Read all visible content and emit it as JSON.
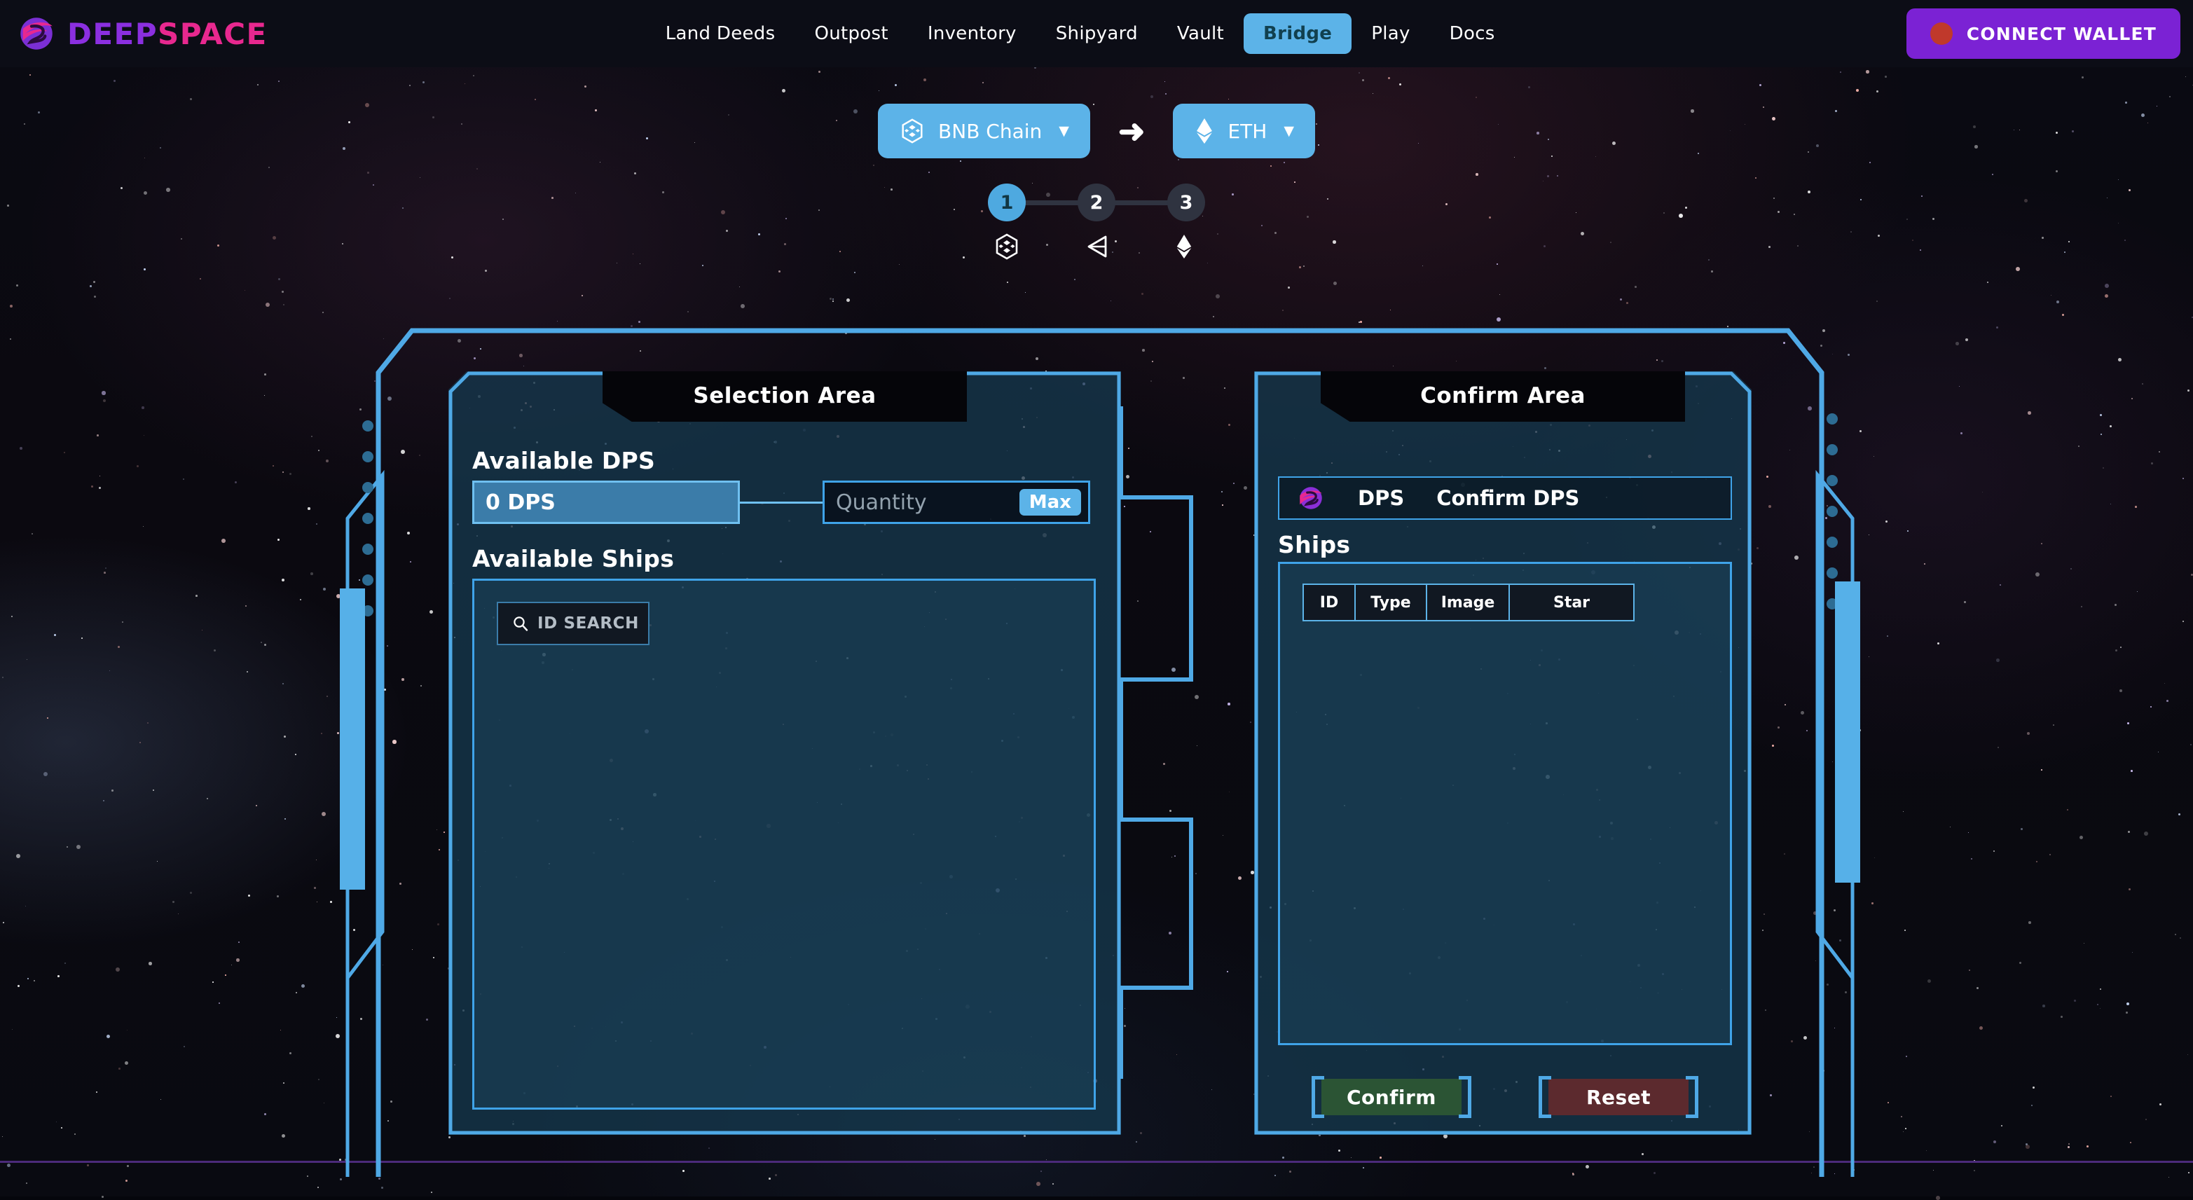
{
  "brand": {
    "name_part1": "DEEP",
    "name_part2": "SPACE",
    "logo_icon": "deepspace-swirl-logo",
    "color_deep": "#8b2fe0",
    "color_space": "#e8288f"
  },
  "nav": {
    "items": [
      {
        "label": "Land Deeds",
        "active": false
      },
      {
        "label": "Outpost",
        "active": false
      },
      {
        "label": "Inventory",
        "active": false
      },
      {
        "label": "Shipyard",
        "active": false
      },
      {
        "label": "Vault",
        "active": false
      },
      {
        "label": "Bridge",
        "active": true
      },
      {
        "label": "Play",
        "active": false
      },
      {
        "label": "Docs",
        "active": false
      }
    ],
    "active_bg": "#5cb3e8",
    "active_fg": "#11404f"
  },
  "wallet": {
    "label": "CONNECT WALLET",
    "icon": "wallet-status-dot",
    "bg": "#7b22d4",
    "dot_color": "#c0392b"
  },
  "bridge": {
    "source_chain": {
      "label": "BNB Chain",
      "icon": "bnb-chain-icon",
      "caret": "▼"
    },
    "direction_icon": "arrow-right-icon",
    "dest_chain": {
      "label": "ETH",
      "icon": "ethereum-icon",
      "caret": "▼"
    },
    "pill_bg": "#5cb3e8"
  },
  "stepper": {
    "steps": [
      {
        "number": "1",
        "icon": "bnb-cube-icon",
        "active": true
      },
      {
        "number": "2",
        "icon": "unity-bridge-icon",
        "active": false
      },
      {
        "number": "3",
        "icon": "ethereum-diamond-icon",
        "active": false
      }
    ],
    "active_color": "#4ea9e0",
    "inactive_color": "#2f3340"
  },
  "selection_area": {
    "title": "Selection Area",
    "available_dps_label": "Available DPS",
    "dps_value": "0 DPS",
    "quantity_placeholder": "Quantity",
    "max_label": "Max",
    "available_ships_label": "Available Ships",
    "search_placeholder": "ID SEARCH",
    "search_icon": "search-icon",
    "ship_rows": []
  },
  "confirm_area": {
    "title": "Confirm Area",
    "summary_icon": "deepspace-swirl-logo",
    "dps_label": "DPS",
    "confirm_dps_label": "Confirm DPS",
    "ships_label": "Ships",
    "table_headers": [
      "ID",
      "Type",
      "Image",
      "Star"
    ],
    "table_rows": [],
    "confirm_button": "Confirm",
    "reset_button": "Reset",
    "confirm_bg": "#2b5434",
    "reset_bg": "#5c2a2e"
  },
  "theme": {
    "hud_blue": "#4fa9e6",
    "panel_bg": "rgba(22,59,82,0.72)",
    "footer_line": "#4b2a7a"
  }
}
